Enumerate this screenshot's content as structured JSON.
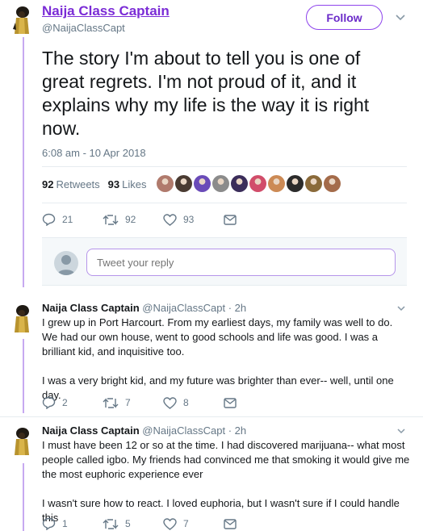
{
  "main_tweet": {
    "author_name": "Naija Class Captain",
    "author_handle": "@NaijaClassCapt",
    "follow_label": "Follow",
    "text": "The story I'm about to tell you is one of great regrets. I'm not proud of it, and it explains why my life is the way it is right now.",
    "timestamp": "6:08 am - 10 Apr 2018",
    "retweets_count": "92",
    "retweets_label": "Retweets",
    "likes_count": "93",
    "likes_label": "Likes",
    "actions": {
      "replies": "21",
      "retweets": "92",
      "likes": "93"
    }
  },
  "reply_box": {
    "placeholder": "Tweet your reply"
  },
  "thread": [
    {
      "author_name": "Naija Class Captain",
      "author_handle": "@NaijaClassCapt",
      "time": "· 2h",
      "paragraphs": [
        "I grew up in Port Harcourt. From my earliest days, my family was well to do. We had our own house, went to good schools and life was good. I was a brilliant kid, and inquisitive too.",
        "I was a very bright kid, and my future was brighter than ever-- well, until one day."
      ],
      "actions": {
        "replies": "2",
        "retweets": "7",
        "likes": "8"
      }
    },
    {
      "author_name": "Naija Class Captain",
      "author_handle": "@NaijaClassCapt",
      "time": "· 2h",
      "paragraphs": [
        "I must have been 12 or so at the time. I had discovered marijuana-- what most people called igbo. My friends had convinced me that smoking it would give me the most euphoric experience ever",
        "I wasn't sure how to react. I loved euphoria, but I wasn't sure if I could handle this"
      ],
      "actions": {
        "replies": "1",
        "retweets": "5",
        "likes": "7"
      }
    }
  ],
  "colors": {
    "accent": "#7b2cd6",
    "thread_line": "#c7a9f0",
    "muted": "#657786",
    "text": "#14171a",
    "divider": "#e6ecf0"
  },
  "icons": [
    "caret-down-icon",
    "reply-icon",
    "retweet-icon",
    "like-icon",
    "direct-message-icon",
    "avatar-icon"
  ],
  "liker_avatars": [
    "#b07a6c",
    "#4a3b32",
    "#6a4bb8",
    "#8b8b8b",
    "#3b2d5a",
    "#d14d6a",
    "#cc8a55",
    "#2b2b2b",
    "#8a6a3a",
    "#a46b4a"
  ]
}
